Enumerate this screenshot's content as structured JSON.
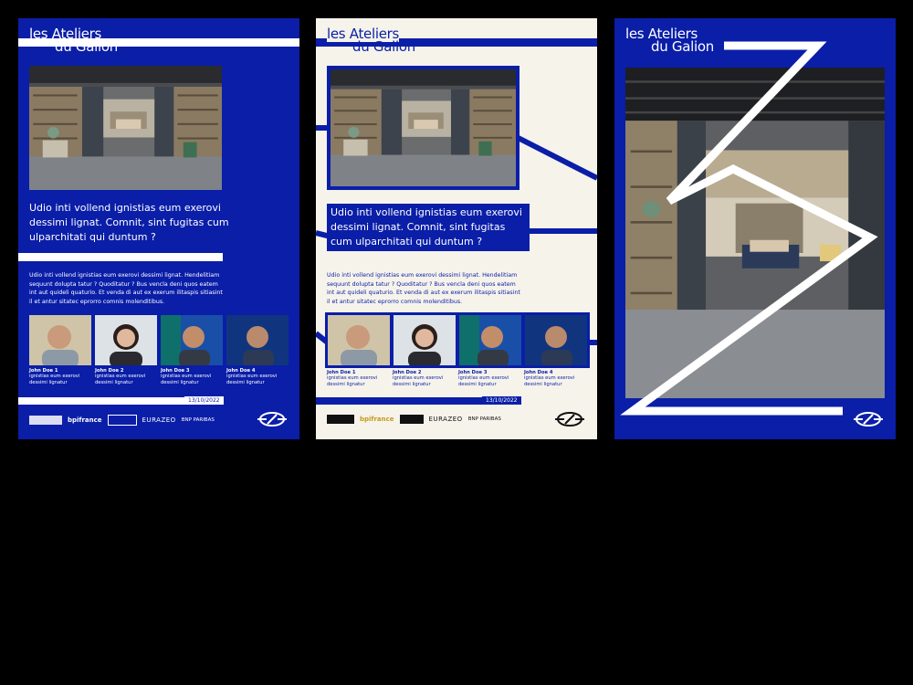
{
  "posters": [
    {
      "title_line1": "les Ateliers",
      "title_line2": "du Galion",
      "headline": "Udio inti vollend ignistias eum exerovi dessimi lignat. Comnit, sint fugitas cum ulparchitati qui duntum ?",
      "body": "Udio inti vollend ignistias eum exerovi dessimi lignat. Hendelitiam sequunt dolupta tatur ? Quoditatur ? Bus vencla deni quos eatem int aut quideli quaturio. Et venda di aut ex exerum ilitaspis sitiasint il et antur sitatec eprorro comnis molenditibus.",
      "date": "13/10/2022"
    },
    {
      "title_line1": "les Ateliers",
      "title_line2": "du Galion",
      "headline": "Udio inti vollend ignistias eum exerovi dessimi lignat. Comnit, sint fugitas cum ulparchitati qui duntum ?",
      "body": "Udio inti vollend ignistias eum exerovi dessimi lignat. Hendelitiam sequunt dolupta tatur ? Quoditatur ? Bus vencla deni quos eatem int aut quideli quaturio. Et venda di aut ex exerum ilitaspis sitiasint il et antur sitatec eprorro comnis molenditibus.",
      "date": "13/10/2022"
    },
    {
      "title_line1": "les Ateliers",
      "title_line2": "du Galion"
    }
  ],
  "people": [
    {
      "name": "John Doe 1",
      "role": "ignistias eum exerovi dessimi lignatur"
    },
    {
      "name": "John Doe 2",
      "role": "ignistias eum exerovi dessimi lignatur"
    },
    {
      "name": "John Doe 3",
      "role": "ignistias eum exerovi dessimi lignatur"
    },
    {
      "name": "John Doe 4",
      "role": "ignistias eum exerovi dessimi lignatur"
    }
  ],
  "partners": [
    "bpifrance",
    "EURAZEO",
    "BNP PARIBAS"
  ],
  "colors": {
    "brand_blue": "#0a1ea8",
    "cream": "#f6f3ea",
    "white": "#ffffff"
  }
}
